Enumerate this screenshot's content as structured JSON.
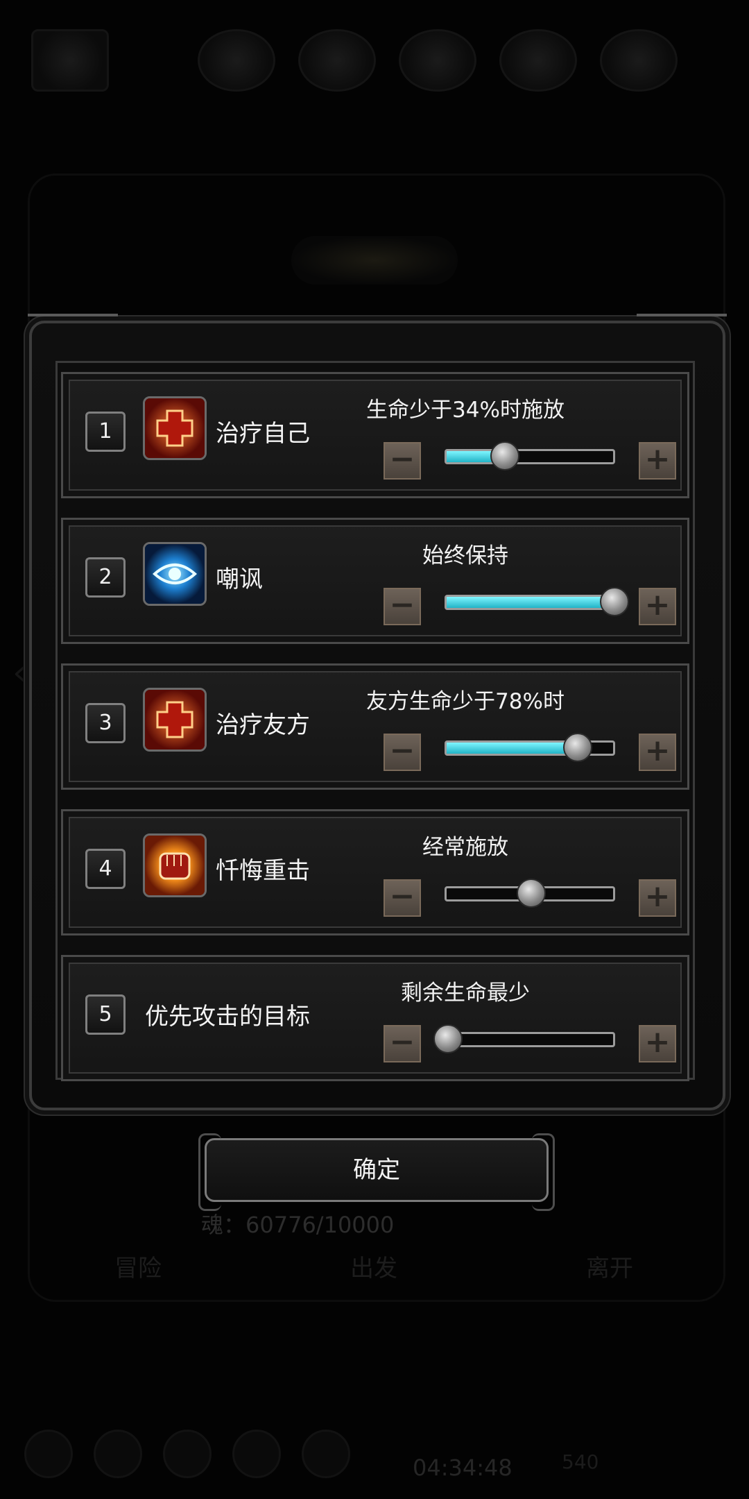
{
  "background": {
    "soul_label": "魂：60776/10000",
    "tabs": [
      "冒险",
      "出发",
      "离开"
    ],
    "timer": "04:34:48",
    "gems": "540"
  },
  "rows": [
    {
      "number": "1",
      "name": "治疗自己",
      "icon": "heal-cross-icon",
      "condition": "生命少于34%时施放",
      "level": 0.34,
      "filled": true
    },
    {
      "number": "2",
      "name": "嘲讽",
      "icon": "eye-taunt-icon",
      "condition": "始终保持",
      "level": 1.0,
      "filled": true
    },
    {
      "number": "3",
      "name": "治疗友方",
      "icon": "heal-cross-icon",
      "condition": "友方生命少于78%时",
      "level": 0.78,
      "filled": true
    },
    {
      "number": "4",
      "name": "忏悔重击",
      "icon": "fist-strike-icon",
      "condition": "经常施放",
      "level": 0.5,
      "filled": false
    },
    {
      "number": "5",
      "name": "优先攻击的目标",
      "icon": "",
      "condition": "剩余生命最少",
      "level": 0.0,
      "filled": false
    }
  ],
  "controls": {
    "minus": "−",
    "plus": "+"
  },
  "confirm_label": "确定",
  "colors": {
    "slider_fill": "#22b3c6",
    "button_bg": "#5a5048"
  }
}
